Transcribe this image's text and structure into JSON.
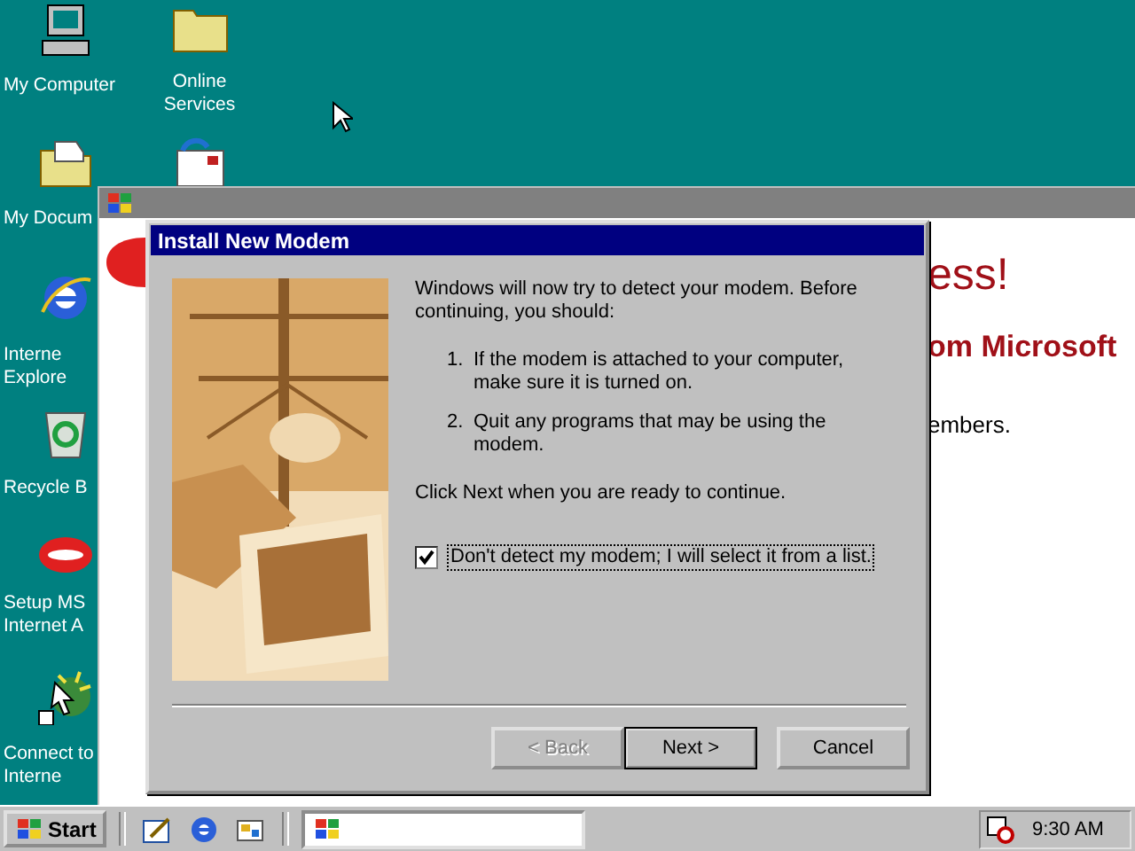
{
  "desktop": {
    "icons": [
      {
        "kind": "computer",
        "lines": [
          "My Computer"
        ]
      },
      {
        "kind": "documents",
        "lines": [
          "My Docum"
        ]
      },
      {
        "kind": "browser",
        "lines": [
          "Interne",
          "Explore"
        ]
      },
      {
        "kind": "recycle",
        "lines": [
          "Recycle B"
        ]
      },
      {
        "kind": "msn",
        "lines": [
          "Setup MS",
          "Internet A"
        ]
      },
      {
        "kind": "connect",
        "lines": [
          "Connect to",
          "Interne"
        ]
      },
      {
        "kind": "folder",
        "lines": [
          "Online",
          "Services"
        ]
      },
      {
        "kind": "mail"
      }
    ]
  },
  "background_window": {
    "active": false,
    "texts": [
      {
        "kind": "headline",
        "text": "ess!"
      },
      {
        "kind": "subhead",
        "text": "om Microsoft"
      },
      {
        "kind": "body",
        "text": "embers."
      }
    ]
  },
  "dialog": {
    "title": "Install New Modem",
    "active": true,
    "intro": "Windows will now try to detect your modem.  Before continuing, you should:",
    "steps": [
      {
        "number": "1.",
        "text": "If the modem is attached to your computer, make sure it is turned on."
      },
      {
        "number": "2.",
        "text": "Quit any programs that may be using the modem."
      }
    ],
    "prompt": "Click Next when you are ready to continue.",
    "checkbox": {
      "label": "Don't detect my modem; I will select it from a list.",
      "checked": true
    },
    "buttons": [
      {
        "label": "< Back",
        "disabled": true,
        "default": false
      },
      {
        "label": "Next >",
        "disabled": false,
        "default": true
      },
      {
        "label": "Cancel",
        "disabled": false,
        "default": false
      }
    ]
  },
  "taskbar": {
    "start": "Start",
    "quick_launch": [
      {
        "kind": "desktop"
      },
      {
        "kind": "browser"
      },
      {
        "kind": "channels"
      }
    ],
    "tasks": [
      {
        "kind": "windows",
        "selected": true
      }
    ],
    "tray": {
      "kind": "scheduler"
    },
    "clock": "9:30 AM"
  }
}
